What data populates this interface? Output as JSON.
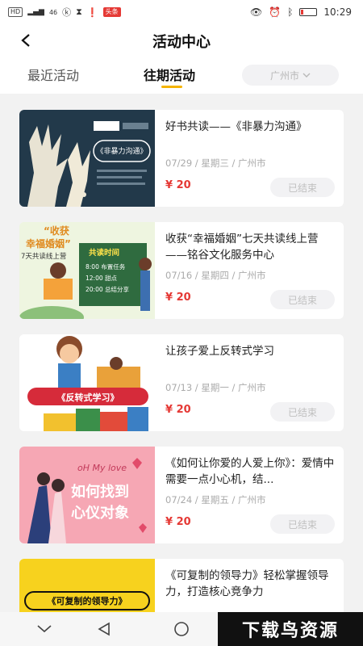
{
  "status_bar": {
    "left_indicators": [
      "HD",
      "46"
    ],
    "badge": "头条",
    "time": "10:29"
  },
  "header": {
    "title": "活动中心"
  },
  "tabs": [
    {
      "label": "最近活动"
    },
    {
      "label": "往期活动"
    }
  ],
  "city_filter": {
    "value": "广州市"
  },
  "activities": [
    {
      "title": "好书共读——《非暴力沟通》",
      "meta": "07/29 / 星期三 / 广州市",
      "price": "¥ 20",
      "status": "已结束",
      "thumb_text": "《非暴力沟通》"
    },
    {
      "title": "收获“幸福婚姻”七天共读线上营——铭谷文化服务中心",
      "meta": "07/16 / 星期四 / 广州市",
      "price": "¥ 20",
      "status": "已结束",
      "thumb_text": "收获幸福婚姻"
    },
    {
      "title": "让孩子爱上反转式学习",
      "meta": "07/13 / 星期一 / 广州市",
      "price": "¥ 20",
      "status": "已结束",
      "thumb_text": "《反转式学习》"
    },
    {
      "title": "《如何让你爱的人爱上你》：爱情中需要一点小心机，结...",
      "meta": "07/24 / 星期五 / 广州市",
      "price": "¥ 20",
      "status": "已结束",
      "thumb_text": "如何找到心仪对象"
    },
    {
      "title": "《可复制的领导力》轻松掌握领导力，打造核心竞争力",
      "meta": "",
      "price": "",
      "status": "",
      "thumb_text": "《可复制的领导力》"
    }
  ],
  "thumb_decor": {
    "t2_top": "“收获",
    "t2_mid": "幸福婚姻”",
    "t2_sub": "7天共读线上营",
    "t2_board": "共读时间",
    "t2_r1": "8:00  布置任务",
    "t2_r2": "12:00  甜点",
    "t2_r3": "20:00  总结分享",
    "t4_top": "oH My love",
    "t4_l1": "如何找到",
    "t4_l2": "心仪对象"
  },
  "watermark": "下载鸟资源",
  "colors": {
    "accent": "#f5b400",
    "price": "#e53935",
    "muted": "#aaaaaa"
  }
}
